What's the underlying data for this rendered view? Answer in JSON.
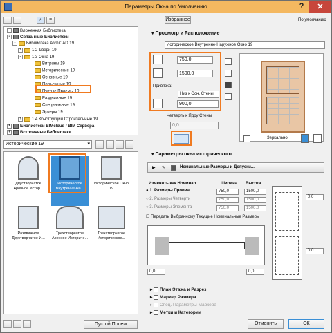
{
  "window": {
    "title": "Параметры Окна по Умолчанию"
  },
  "toolbar": {
    "favorites_label": "Избранное",
    "default_label": "По умолчанию"
  },
  "tree": {
    "items": [
      {
        "label": "Вложенная Библиотека",
        "kind": "lib"
      },
      {
        "label": "Связанные Библиотеки",
        "kind": "lib",
        "bold": true
      },
      {
        "label": "Библиотека ArchiCAD 19",
        "kind": "folder"
      },
      {
        "label": "1.2 Двери 19",
        "kind": "folder"
      },
      {
        "label": "1.3 Окна 19",
        "kind": "folder"
      },
      {
        "label": "Витрины 19",
        "kind": "folder"
      },
      {
        "label": "Исторические 19",
        "kind": "folder"
      },
      {
        "label": "Основные 19",
        "kind": "folder"
      },
      {
        "label": "Подъемные 19",
        "kind": "folder"
      },
      {
        "label": "Пустые Проемы 19",
        "kind": "folder"
      },
      {
        "label": "Раздвижные 19",
        "kind": "folder"
      },
      {
        "label": "Специальные 19",
        "kind": "folder"
      },
      {
        "label": "Эркеры 19",
        "kind": "folder"
      },
      {
        "label": "1.4 Конструкции Строительные 19",
        "kind": "folder"
      },
      {
        "label": "Библиотеки BIMcloud / BIM Сервера",
        "kind": "lib",
        "bold": true
      },
      {
        "label": "Встроенные Библиотеки",
        "kind": "lib",
        "bold": true
      }
    ]
  },
  "folder_select": {
    "value": "Исторические 19"
  },
  "thumbs": [
    {
      "label": "Двустворчатое Арочное Истор..."
    },
    {
      "label": "Историческое Внутренне-На...",
      "selected": true
    },
    {
      "label": "Историческое Окно 19"
    },
    {
      "label": "Раздвижное Двустворчатое И..."
    },
    {
      "label": "Трехстворчатое Арочное Историче..."
    },
    {
      "label": "Трехстворчатое Историческое..."
    }
  ],
  "empty_opening_button": "Пустой Проем",
  "preview": {
    "section_title": "Просмотр и Расположение",
    "object_name": "Историческое Внутренне-Наружное Окно 19",
    "width_value": "750,0",
    "height_value": "1500,0",
    "anchor_label": "Привязка:",
    "anchor_mode": "Низ к Осн. Стены",
    "sill_value": "900,0",
    "reveal_label": "Четверть к Ядру Стены",
    "reveal_value": "0,0",
    "mirror_label": "Зеркально"
  },
  "params": {
    "section_title": "Параметры окна исторического",
    "subsection": "Номинальные Размеры и Допуски...",
    "change_label": "Изменить как Номинал",
    "width_header": "Ширина",
    "height_header": "Высота",
    "rows": [
      {
        "label": "1. Размеры Проема",
        "width": "750,0",
        "height": "1500,0",
        "active": true
      },
      {
        "label": "2. Размеры Четверти",
        "width": "750,0",
        "height": "1500,0",
        "active": false
      },
      {
        "label": "3. Размеры Элемента",
        "width": "750,0",
        "height": "1500,0",
        "active": false
      }
    ],
    "checkbox_label": "Передать Выбранному Текущие Номинальные Размеры",
    "right_value_top": "0,0",
    "right_value_bottom": "0,0",
    "mid_value_left": "0,0",
    "mid_value_right": "0,0"
  },
  "bottom_sections": [
    {
      "label": "План Этажа и Разрез"
    },
    {
      "label": "Маркер Размера"
    },
    {
      "label": "Спец. Параметры Маркера",
      "dim": true
    },
    {
      "label": "Метки и Категории"
    }
  ],
  "buttons": {
    "cancel": "Отменить",
    "ok": "ОК"
  },
  "colors": {
    "highlight": "#f07a20",
    "selection": "#3a8fd6",
    "titlebar": "#f4b860",
    "close": "#c7463b"
  }
}
